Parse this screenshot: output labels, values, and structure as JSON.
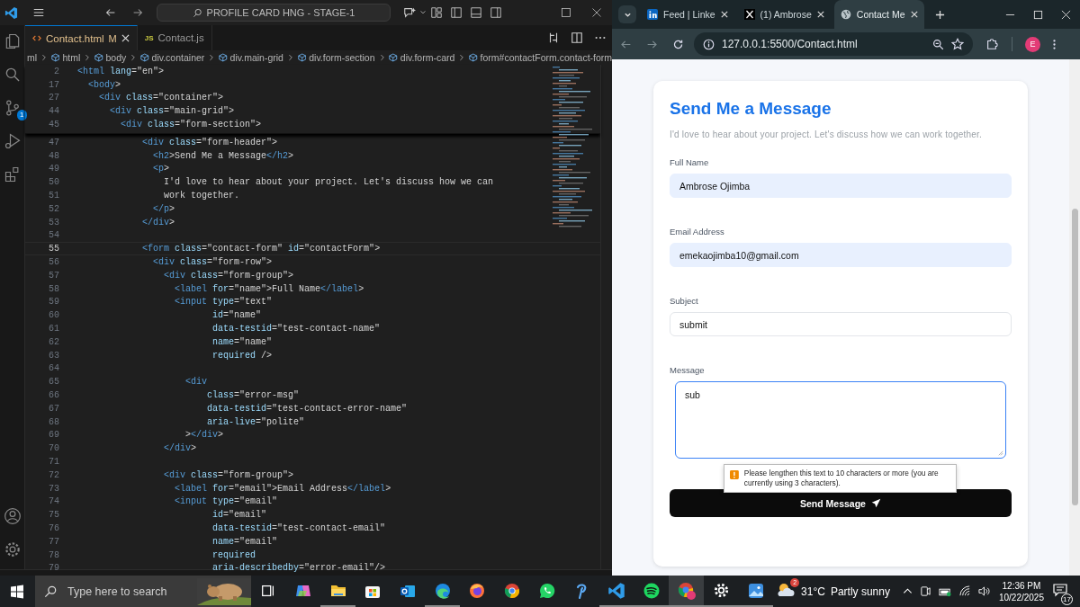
{
  "editor": {
    "command_center": "PROFILE CARD HNG - STAGE-1",
    "source_control_badge": "1",
    "tabs": [
      {
        "kind": "html",
        "label": "Contact.html",
        "status": "M",
        "selected": true
      },
      {
        "kind": "js",
        "icon_text": "JS",
        "label": "Contact.js",
        "selected": false
      }
    ],
    "breadcrumbs": [
      "ml",
      "html",
      "body",
      "div.container",
      "div.main-grid",
      "div.form-section",
      "div.form-card",
      "form#contactForm.contact-form"
    ],
    "sticky_lines": [
      {
        "number": "2",
        "tokens": [
          {
            "kind": "tag",
            "text": "<html"
          },
          {
            "kind": "attr",
            "text": " lang"
          },
          {
            "kind": "punct",
            "text": "="
          },
          {
            "kind": "string",
            "text": "\"en\""
          },
          {
            "kind": "punct",
            "text": ">"
          }
        ]
      },
      {
        "number": "17",
        "tokens": [
          {
            "kind": "tag",
            "text": "  <body"
          },
          {
            "kind": "punct",
            "text": ">"
          }
        ]
      },
      {
        "number": "27",
        "tokens": [
          {
            "kind": "tag",
            "text": "    <div"
          },
          {
            "kind": "attr",
            "text": " class"
          },
          {
            "kind": "punct",
            "text": "="
          },
          {
            "kind": "string",
            "text": "\"container\""
          },
          {
            "kind": "punct",
            "text": ">"
          }
        ]
      },
      {
        "number": "44",
        "tokens": [
          {
            "kind": "tag",
            "text": "      <div"
          },
          {
            "kind": "attr",
            "text": " class"
          },
          {
            "kind": "punct",
            "text": "="
          },
          {
            "kind": "string",
            "text": "\"main-grid\""
          },
          {
            "kind": "punct",
            "text": ">"
          }
        ]
      },
      {
        "number": "45",
        "tokens": [
          {
            "kind": "tag",
            "text": "        <div"
          },
          {
            "kind": "attr",
            "text": " class"
          },
          {
            "kind": "punct",
            "text": "="
          },
          {
            "kind": "string",
            "text": "\"form-section\""
          },
          {
            "kind": "punct",
            "text": ">"
          }
        ]
      }
    ],
    "lines": [
      {
        "number": "47",
        "current": false,
        "tokens": [
          {
            "kind": "tag",
            "text": "            <div"
          },
          {
            "kind": "attr",
            "text": " class"
          },
          {
            "kind": "punct",
            "text": "="
          },
          {
            "kind": "string",
            "text": "\"form-header\""
          },
          {
            "kind": "punct",
            "text": ">"
          }
        ]
      },
      {
        "number": "48",
        "current": false,
        "tokens": [
          {
            "kind": "tag",
            "text": "              <h2"
          },
          {
            "kind": "punct",
            "text": ">"
          },
          {
            "kind": "plain",
            "text": "Send Me a Message"
          },
          {
            "kind": "tag",
            "text": "</h2"
          },
          {
            "kind": "punct",
            "text": ">"
          }
        ]
      },
      {
        "number": "49",
        "current": false,
        "tokens": [
          {
            "kind": "tag",
            "text": "              <p"
          },
          {
            "kind": "punct",
            "text": ">"
          }
        ]
      },
      {
        "number": "50",
        "current": false,
        "tokens": [
          {
            "kind": "plain",
            "text": "                I'd love to hear about your project. Let's discuss how we can"
          }
        ]
      },
      {
        "number": "51",
        "current": false,
        "tokens": [
          {
            "kind": "plain",
            "text": "                work together."
          }
        ]
      },
      {
        "number": "52",
        "current": false,
        "tokens": [
          {
            "kind": "tag",
            "text": "              </p"
          },
          {
            "kind": "punct",
            "text": ">"
          }
        ]
      },
      {
        "number": "53",
        "current": false,
        "tokens": [
          {
            "kind": "tag",
            "text": "            </div"
          },
          {
            "kind": "punct",
            "text": ">"
          }
        ]
      },
      {
        "number": "54",
        "current": false
      },
      {
        "number": "55",
        "current": true,
        "tokens": [
          {
            "kind": "tag",
            "text": "            <form"
          },
          {
            "kind": "attr",
            "text": " class"
          },
          {
            "kind": "punct",
            "text": "="
          },
          {
            "kind": "string",
            "text": "\"contact-form\""
          },
          {
            "kind": "attr",
            "text": " id"
          },
          {
            "kind": "punct",
            "text": "="
          },
          {
            "kind": "string",
            "text": "\"contactForm\""
          },
          {
            "kind": "punct",
            "text": ">"
          }
        ]
      },
      {
        "number": "56",
        "current": false,
        "tokens": [
          {
            "kind": "tag",
            "text": "              <div"
          },
          {
            "kind": "attr",
            "text": " class"
          },
          {
            "kind": "punct",
            "text": "="
          },
          {
            "kind": "string",
            "text": "\"form-row\""
          },
          {
            "kind": "punct",
            "text": ">"
          }
        ]
      },
      {
        "number": "57",
        "current": false,
        "tokens": [
          {
            "kind": "tag",
            "text": "                <div"
          },
          {
            "kind": "attr",
            "text": " class"
          },
          {
            "kind": "punct",
            "text": "="
          },
          {
            "kind": "string",
            "text": "\"form-group\""
          },
          {
            "kind": "punct",
            "text": ">"
          }
        ]
      },
      {
        "number": "58",
        "current": false,
        "tokens": [
          {
            "kind": "tag",
            "text": "                  <label"
          },
          {
            "kind": "attr",
            "text": " for"
          },
          {
            "kind": "punct",
            "text": "="
          },
          {
            "kind": "string",
            "text": "\"name\""
          },
          {
            "kind": "punct",
            "text": ">"
          },
          {
            "kind": "plain",
            "text": "Full Name"
          },
          {
            "kind": "tag",
            "text": "</label"
          },
          {
            "kind": "punct",
            "text": ">"
          }
        ]
      },
      {
        "number": "59",
        "current": false,
        "tokens": [
          {
            "kind": "tag",
            "text": "                  <input"
          },
          {
            "kind": "attr",
            "text": " type"
          },
          {
            "kind": "punct",
            "text": "="
          },
          {
            "kind": "string",
            "text": "\"text\""
          }
        ]
      },
      {
        "number": "60",
        "current": false,
        "tokens": [
          {
            "kind": "attr",
            "text": "                         id"
          },
          {
            "kind": "punct",
            "text": "="
          },
          {
            "kind": "string",
            "text": "\"name\""
          }
        ]
      },
      {
        "number": "61",
        "current": false,
        "tokens": [
          {
            "kind": "attr",
            "text": "                         data-testid"
          },
          {
            "kind": "punct",
            "text": "="
          },
          {
            "kind": "string",
            "text": "\"test-contact-name\""
          }
        ]
      },
      {
        "number": "62",
        "current": false,
        "tokens": [
          {
            "kind": "attr",
            "text": "                         name"
          },
          {
            "kind": "punct",
            "text": "="
          },
          {
            "kind": "string",
            "text": "\"name\""
          }
        ]
      },
      {
        "number": "63",
        "current": false,
        "tokens": [
          {
            "kind": "attr",
            "text": "                         required"
          },
          {
            "kind": "punct",
            "text": " />"
          }
        ]
      },
      {
        "number": "64",
        "current": false
      },
      {
        "number": "65",
        "current": false,
        "tokens": [
          {
            "kind": "tag",
            "text": "                    <div"
          }
        ]
      },
      {
        "number": "66",
        "current": false,
        "tokens": [
          {
            "kind": "attr",
            "text": "                        class"
          },
          {
            "kind": "punct",
            "text": "="
          },
          {
            "kind": "string",
            "text": "\"error-msg\""
          }
        ]
      },
      {
        "number": "67",
        "current": false,
        "tokens": [
          {
            "kind": "attr",
            "text": "                        data-testid"
          },
          {
            "kind": "punct",
            "text": "="
          },
          {
            "kind": "string",
            "text": "\"test-contact-error-name\""
          }
        ]
      },
      {
        "number": "68",
        "current": false,
        "tokens": [
          {
            "kind": "attr",
            "text": "                        aria-live"
          },
          {
            "kind": "punct",
            "text": "="
          },
          {
            "kind": "string",
            "text": "\"polite\""
          }
        ]
      },
      {
        "number": "69",
        "current": false,
        "tokens": [
          {
            "kind": "punct",
            "text": "                    >"
          },
          {
            "kind": "tag",
            "text": "</div"
          },
          {
            "kind": "punct",
            "text": ">"
          }
        ]
      },
      {
        "number": "70",
        "current": false,
        "tokens": [
          {
            "kind": "tag",
            "text": "                </div"
          },
          {
            "kind": "punct",
            "text": ">"
          }
        ]
      },
      {
        "number": "71",
        "current": false
      },
      {
        "number": "72",
        "current": false,
        "tokens": [
          {
            "kind": "tag",
            "text": "                <div"
          },
          {
            "kind": "attr",
            "text": " class"
          },
          {
            "kind": "punct",
            "text": "="
          },
          {
            "kind": "string",
            "text": "\"form-group\""
          },
          {
            "kind": "punct",
            "text": ">"
          }
        ]
      },
      {
        "number": "73",
        "current": false,
        "tokens": [
          {
            "kind": "tag",
            "text": "                  <label"
          },
          {
            "kind": "attr",
            "text": " for"
          },
          {
            "kind": "punct",
            "text": "="
          },
          {
            "kind": "string",
            "text": "\"email\""
          },
          {
            "kind": "punct",
            "text": ">"
          },
          {
            "kind": "plain",
            "text": "Email Address"
          },
          {
            "kind": "tag",
            "text": "</label"
          },
          {
            "kind": "punct",
            "text": ">"
          }
        ]
      },
      {
        "number": "74",
        "current": false,
        "tokens": [
          {
            "kind": "tag",
            "text": "                  <input"
          },
          {
            "kind": "attr",
            "text": " type"
          },
          {
            "kind": "punct",
            "text": "="
          },
          {
            "kind": "string",
            "text": "\"email\""
          }
        ]
      },
      {
        "number": "75",
        "current": false,
        "tokens": [
          {
            "kind": "attr",
            "text": "                         id"
          },
          {
            "kind": "punct",
            "text": "="
          },
          {
            "kind": "string",
            "text": "\"email\""
          }
        ]
      },
      {
        "number": "76",
        "current": false,
        "tokens": [
          {
            "kind": "attr",
            "text": "                         data-testid"
          },
          {
            "kind": "punct",
            "text": "="
          },
          {
            "kind": "string",
            "text": "\"test-contact-email\""
          }
        ]
      },
      {
        "number": "77",
        "current": false,
        "tokens": [
          {
            "kind": "attr",
            "text": "                         name"
          },
          {
            "kind": "punct",
            "text": "="
          },
          {
            "kind": "string",
            "text": "\"email\""
          }
        ]
      },
      {
        "number": "78",
        "current": false,
        "tokens": [
          {
            "kind": "attr",
            "text": "                         required"
          }
        ]
      },
      {
        "number": "79",
        "current": false,
        "tokens": [
          {
            "kind": "attr",
            "text": "                         aria-describedby"
          },
          {
            "kind": "punct",
            "text": "="
          },
          {
            "kind": "string",
            "text": "\"error-email\""
          },
          {
            "kind": "punct",
            "text": "/>"
          }
        ]
      }
    ]
  },
  "browser": {
    "tabs": [
      {
        "kind": "linkedin",
        "label": "Feed | Linke",
        "selected": false
      },
      {
        "kind": "x",
        "label": "(1) Ambrose",
        "selected": false
      },
      {
        "kind": "globe",
        "label": "Contact Me",
        "selected": true
      }
    ],
    "url": "127.0.0.1:5500/Contact.html",
    "profile_initial": "E",
    "page": {
      "title": "Send Me a Message",
      "subtitle": "I'd love to hear about your project. Let's discuss how we can work together.",
      "fields": [
        {
          "kind": "input",
          "label": "Full Name",
          "value": "Ambrose Ojimba",
          "autofilled": true,
          "focused": false
        },
        {
          "kind": "input",
          "label": "Email Address",
          "value": "emekaojimba10@gmail.com",
          "autofilled": true,
          "focused": false
        },
        {
          "kind": "input",
          "label": "Subject",
          "value": "submit",
          "autofilled": false,
          "focused": false
        },
        {
          "kind": "textarea",
          "label": "Message",
          "value": "sub",
          "autofilled": false,
          "focused": true
        }
      ],
      "tooltip": "Please lengthen this text to 10 characters or more (you are currently using 3 characters).",
      "submit": "Send Message"
    }
  },
  "taskbar": {
    "search_placeholder": "Type here to search",
    "apps": [
      {
        "kind": "taskview",
        "running": false
      },
      {
        "kind": "copilot",
        "running": false
      },
      {
        "kind": "explorer",
        "running": true
      },
      {
        "kind": "store",
        "running": false
      },
      {
        "kind": "outlook",
        "running": false
      },
      {
        "kind": "edge",
        "running": true
      },
      {
        "kind": "firefox",
        "running": false
      },
      {
        "kind": "chrome",
        "running": false
      },
      {
        "kind": "whatsapp",
        "running": false
      },
      {
        "kind": "pen",
        "running": false
      },
      {
        "kind": "vscode",
        "running": true
      },
      {
        "kind": "spotify",
        "running": true
      },
      {
        "kind": "chrome-profile",
        "running": true
      },
      {
        "kind": "settings",
        "running": true
      },
      {
        "kind": "photos",
        "running": true
      }
    ],
    "weather": {
      "badge": "2",
      "temperature": "31°C",
      "condition": "Partly sunny"
    },
    "time": "12:36 PM",
    "date": "10/22/2025",
    "notifications": "17"
  }
}
